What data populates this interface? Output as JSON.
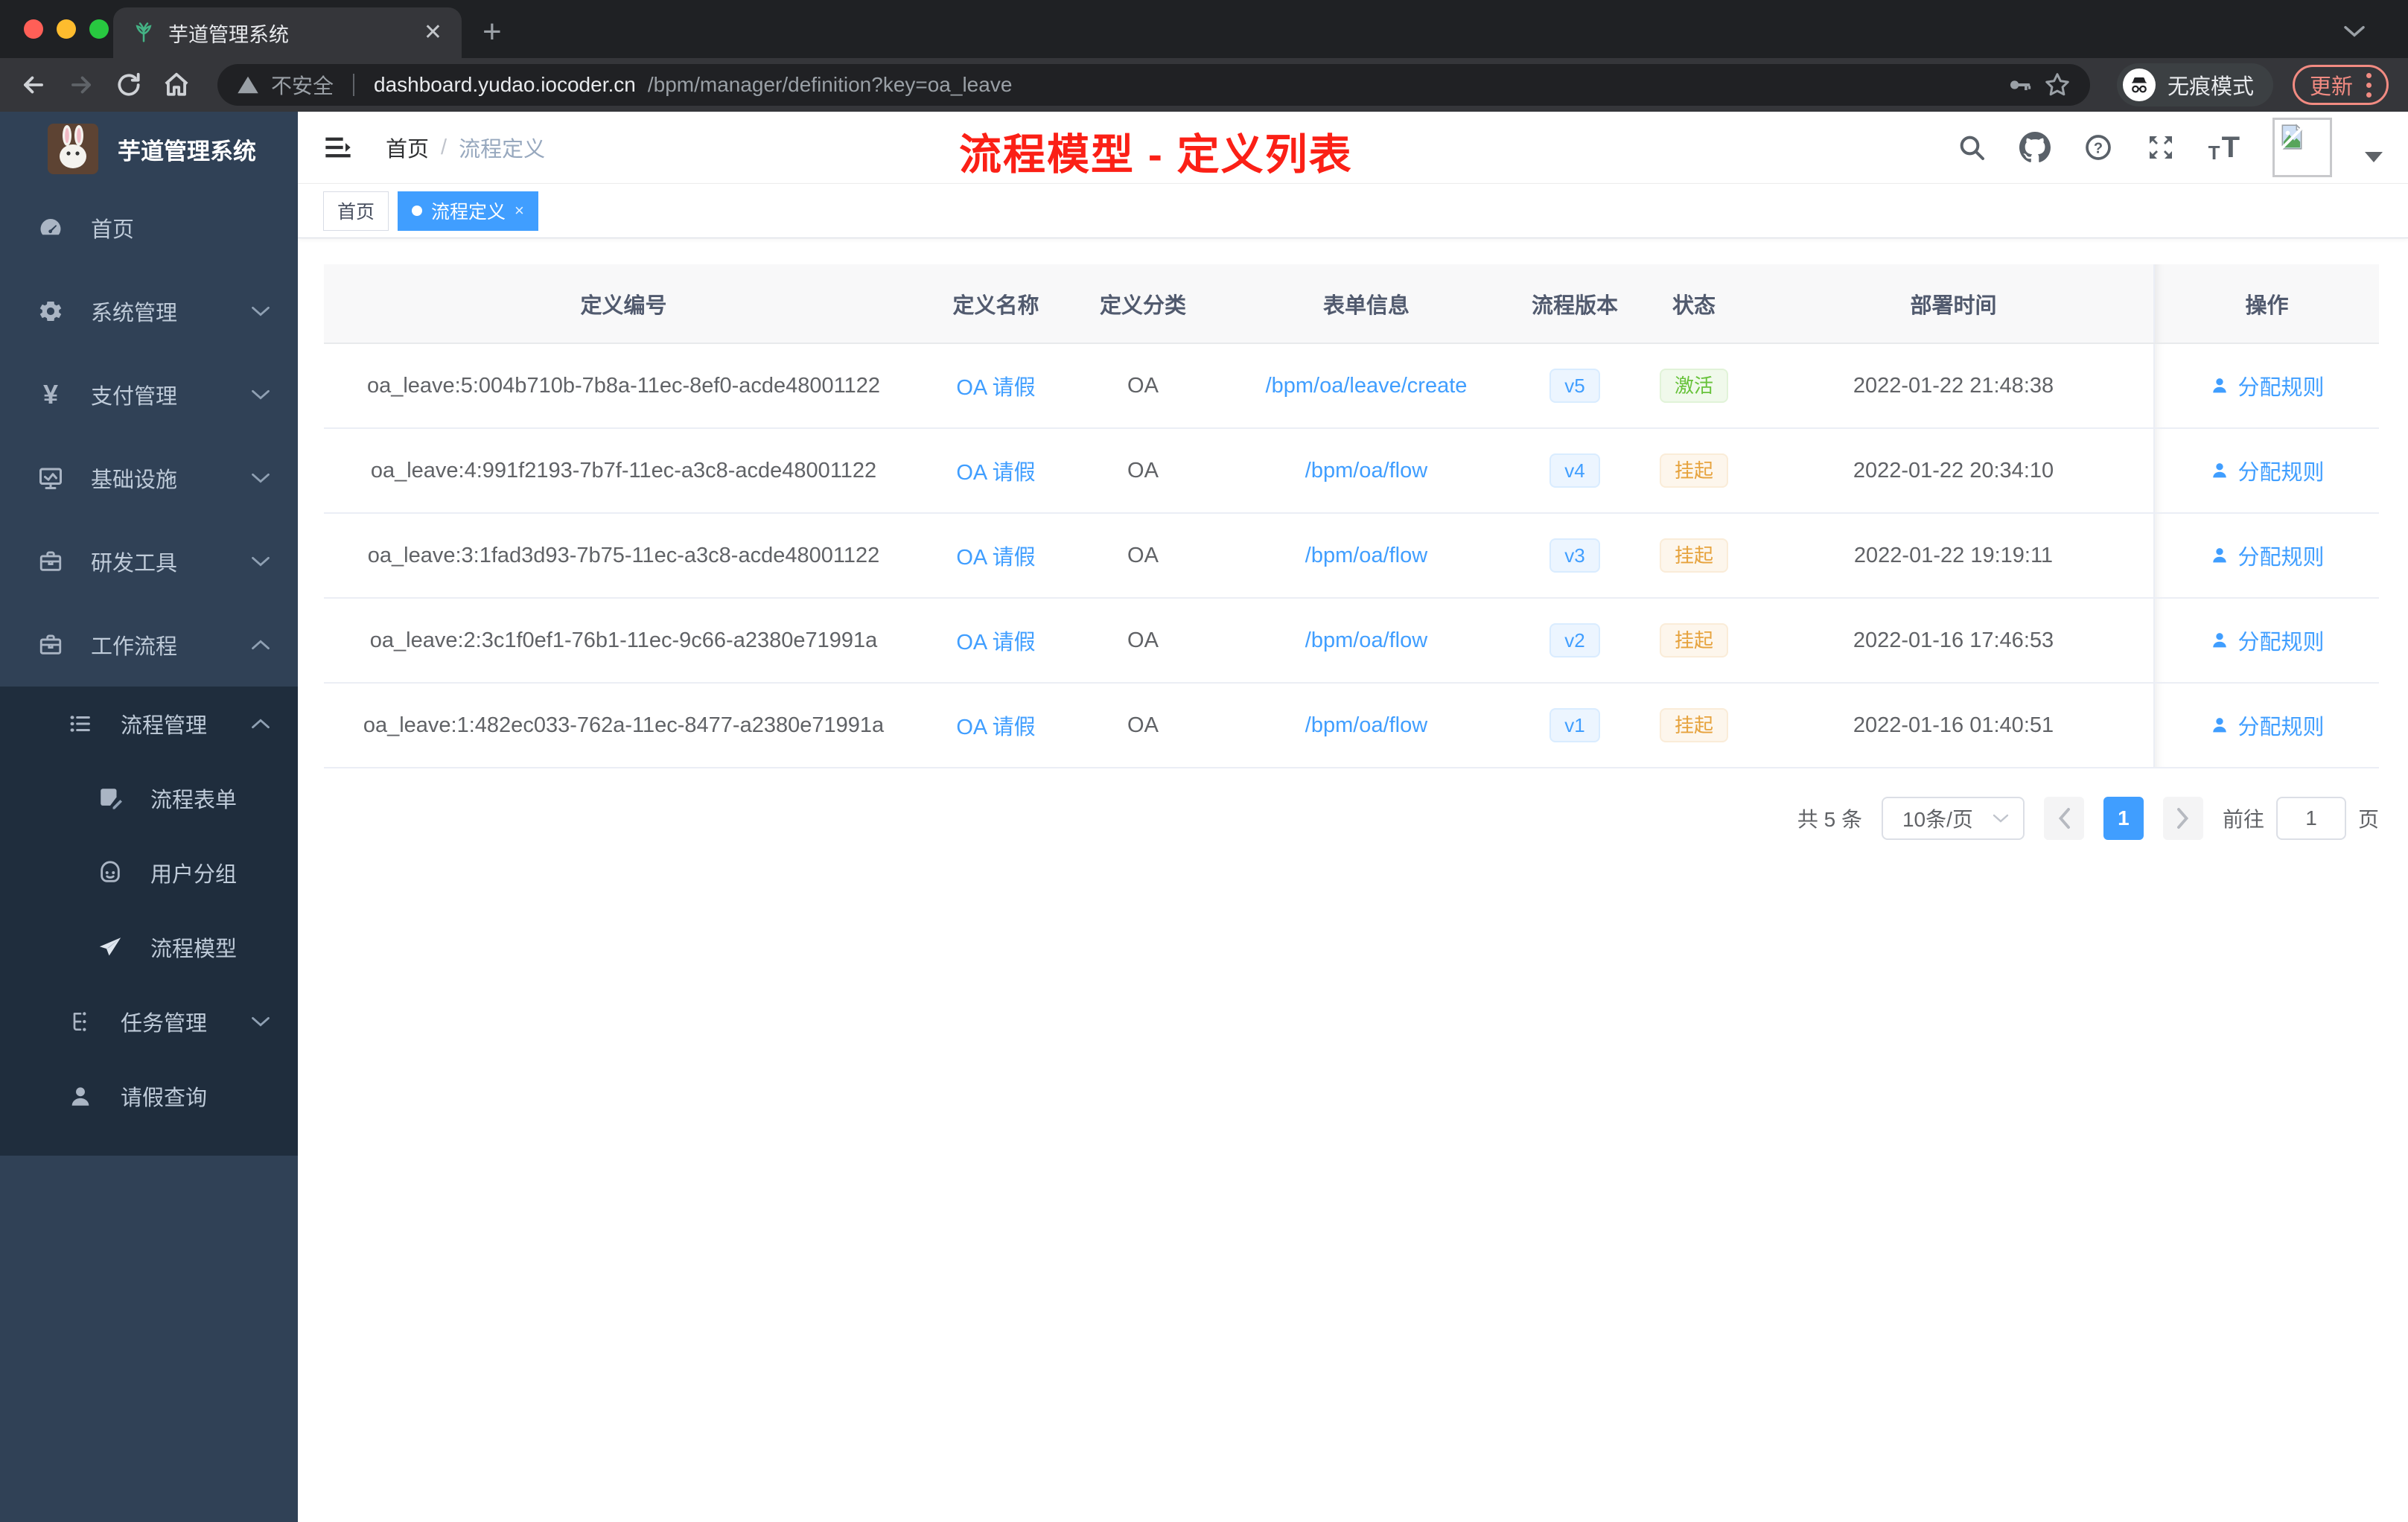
{
  "browser": {
    "tab_title": "芋道管理系统",
    "security_label": "不安全",
    "url_host": "dashboard.yudao.iocoder.cn",
    "url_path": "/bpm/manager/definition?key=oa_leave",
    "incognito_label": "无痕模式",
    "update_label": "更新"
  },
  "sidebar": {
    "app_title": "芋道管理系统",
    "items": [
      {
        "label": "首页"
      },
      {
        "label": "系统管理"
      },
      {
        "label": "支付管理"
      },
      {
        "label": "基础设施"
      },
      {
        "label": "研发工具"
      },
      {
        "label": "工作流程"
      },
      {
        "label": "流程管理"
      },
      {
        "label": "流程表单"
      },
      {
        "label": "用户分组"
      },
      {
        "label": "流程模型"
      },
      {
        "label": "任务管理"
      },
      {
        "label": "请假查询"
      }
    ]
  },
  "header": {
    "breadcrumb_home": "首页",
    "breadcrumb_sep": "/",
    "breadcrumb_current": "流程定义",
    "annotation": "流程模型 - 定义列表",
    "annotation_color": "#fb2016"
  },
  "tags": [
    {
      "label": "首页",
      "active": false
    },
    {
      "label": "流程定义",
      "active": true,
      "close": "×"
    }
  ],
  "table": {
    "columns": [
      "定义编号",
      "定义名称",
      "定义分类",
      "表单信息",
      "流程版本",
      "状态",
      "部署时间",
      "操作"
    ],
    "action_label": "分配规则",
    "rows": [
      {
        "id": "oa_leave:5:004b710b-7b8a-11ec-8ef0-acde48001122",
        "name": "OA 请假",
        "category": "OA",
        "form": "/bpm/oa/leave/create",
        "version": "v5",
        "status": "激活",
        "status_type": "green",
        "deployed": "2022-01-22 21:48:38"
      },
      {
        "id": "oa_leave:4:991f2193-7b7f-11ec-a3c8-acde48001122",
        "name": "OA 请假",
        "category": "OA",
        "form": "/bpm/oa/flow",
        "version": "v4",
        "status": "挂起",
        "status_type": "orange",
        "deployed": "2022-01-22 20:34:10"
      },
      {
        "id": "oa_leave:3:1fad3d93-7b75-11ec-a3c8-acde48001122",
        "name": "OA 请假",
        "category": "OA",
        "form": "/bpm/oa/flow",
        "version": "v3",
        "status": "挂起",
        "status_type": "orange",
        "deployed": "2022-01-22 19:19:11"
      },
      {
        "id": "oa_leave:2:3c1f0ef1-76b1-11ec-9c66-a2380e71991a",
        "name": "OA 请假",
        "category": "OA",
        "form": "/bpm/oa/flow",
        "version": "v2",
        "status": "挂起",
        "status_type": "orange",
        "deployed": "2022-01-16 17:46:53"
      },
      {
        "id": "oa_leave:1:482ec033-762a-11ec-8477-a2380e71991a",
        "name": "OA 请假",
        "category": "OA",
        "form": "/bpm/oa/flow",
        "version": "v1",
        "status": "挂起",
        "status_type": "orange",
        "deployed": "2022-01-16 01:40:51"
      }
    ]
  },
  "pagination": {
    "total": "共 5 条",
    "page_size": "10条/页",
    "current_page": "1",
    "goto_label": "前往",
    "goto_value": "1",
    "page_unit": "页"
  },
  "colors": {
    "accent": "#409eff",
    "sidebar_bg": "#304156",
    "submenu_bg": "#1f2d3d",
    "status_active": "#67c23a",
    "status_suspended": "#e6a23c",
    "update_pill": "#f28b82"
  }
}
